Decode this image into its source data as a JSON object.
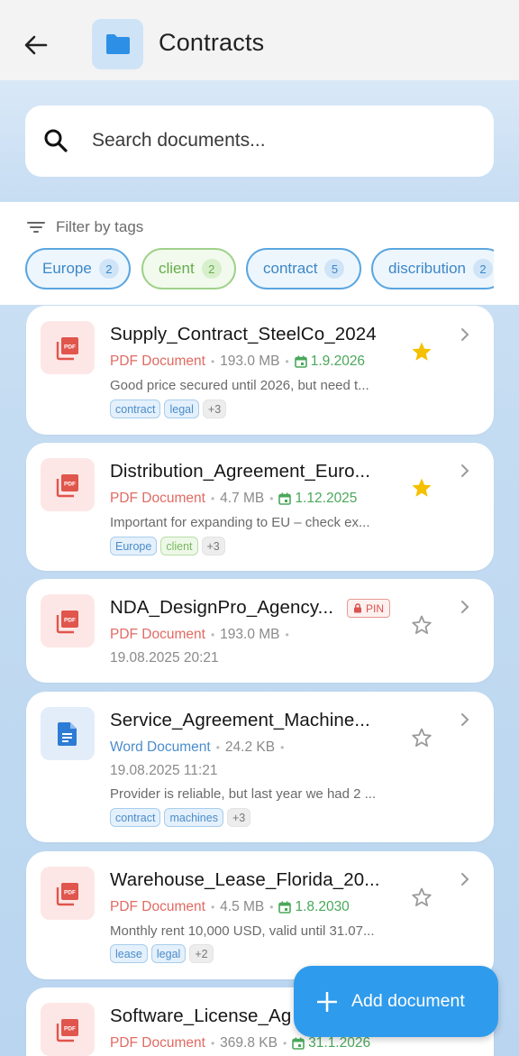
{
  "header": {
    "title": "Contracts"
  },
  "search": {
    "placeholder": "Search documents..."
  },
  "filter": {
    "label": "Filter by tags",
    "chips": [
      {
        "label": "Europe",
        "count": "2",
        "color": "blue"
      },
      {
        "label": "client",
        "count": "2",
        "color": "green"
      },
      {
        "label": "contract",
        "count": "5",
        "color": "blue"
      },
      {
        "label": "discribution",
        "count": "2",
        "color": "blue"
      }
    ]
  },
  "documents": [
    {
      "title": "Supply_Contract_SteelCo_2024",
      "type": "PDF Document",
      "size": "193.0 MB",
      "date": "1.9.2026",
      "description": "Good price secured until 2026, but need t...",
      "tags": [
        "contract",
        "legal"
      ],
      "more": "+3",
      "starred": true
    },
    {
      "title": "Distribution_Agreement_Euro...",
      "type": "PDF Document",
      "size": "4.7 MB",
      "date": "1.12.2025",
      "description": "Important for expanding to EU – check ex...",
      "tags": [
        "Europe",
        "client"
      ],
      "more": "+3",
      "starred": true
    },
    {
      "title": "NDA_DesignPro_Agency...",
      "type": "PDF Document",
      "size": "193.0 MB",
      "modified": "19.08.2025 20:21",
      "pin": "PIN",
      "starred": false
    },
    {
      "title": "Service_Agreement_Machine...",
      "type": "Word Document",
      "size": "24.2 KB",
      "modified": "19.08.2025 11:21",
      "description": "Provider is reliable, but last year we had 2 ...",
      "tags": [
        "contract",
        "machines"
      ],
      "more": "+3",
      "starred": false
    },
    {
      "title": "Warehouse_Lease_Florida_20...",
      "type": "PDF Document",
      "size": "4.5 MB",
      "date": "1.8.2030",
      "description": "Monthly rent 10,000 USD, valid until 31.07...",
      "tags": [
        "lease",
        "legal"
      ],
      "more": "+2",
      "starred": false
    },
    {
      "title": "Software_License_Ag",
      "type": "PDF Document",
      "size": "369.8 KB",
      "date": "31.1.2026"
    }
  ],
  "fab": {
    "label": "Add document"
  },
  "colors": {
    "accent": "#2f9bec",
    "pdf": "#e06a62",
    "word": "#4b8ccb",
    "date": "#4aa85a",
    "star": "#f5c000"
  }
}
